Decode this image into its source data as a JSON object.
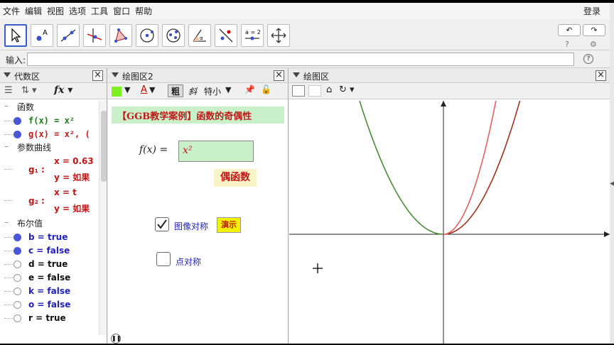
{
  "menu": {
    "items": [
      "文件",
      "编辑",
      "视图",
      "选项",
      "工具",
      "窗口",
      "帮助"
    ],
    "login": "登录"
  },
  "toolbar": {
    "tools": [
      "move-tool",
      "point-tool",
      "line-tool",
      "perpendicular-tool",
      "polygon-tool",
      "circle-tool",
      "conic-tool",
      "angle-tool",
      "reflect-tool",
      "slider-tool",
      "move-view-tool"
    ],
    "slider_label": "a = 2"
  },
  "input": {
    "label": "输入:",
    "value": ""
  },
  "algebra": {
    "title": "代数区",
    "categories": {
      "functions": "函数",
      "curves": "参数曲线",
      "booleans": "布尔值"
    },
    "functions": [
      {
        "name": "f(x) = x²",
        "color": "#1a7a1a"
      },
      {
        "name": "g(x) = x²,   (",
        "color": "#c01818"
      }
    ],
    "curves": [
      {
        "name": "g₁ :",
        "line1": "x = 0.63",
        "line2": "y = 如果",
        "visible": true
      },
      {
        "name": "g₂ :",
        "line1": "x = t",
        "line2": "y = 如果",
        "visible": false
      }
    ],
    "booleans": [
      {
        "label": "b = true",
        "visible": true,
        "color": "#2222bb"
      },
      {
        "label": "c = false",
        "visible": true,
        "color": "#2222bb"
      },
      {
        "label": "d = true",
        "visible": false,
        "color": "#111111"
      },
      {
        "label": "e = false",
        "visible": false,
        "color": "#111111"
      },
      {
        "label": "k = false",
        "visible": false,
        "color": "#2222bb"
      },
      {
        "label": "o = false",
        "visible": false,
        "color": "#2222bb"
      },
      {
        "label": "r = true",
        "visible": false,
        "color": "#111111"
      }
    ]
  },
  "graphics2": {
    "title": "绘图区2",
    "style_bold": "粗",
    "style_italic": "斜",
    "style_size": "特小",
    "heading": "【GGB教学案例】函数的奇偶性",
    "f_label": "f(x) =",
    "f_value": "x²",
    "even_button": "偶函数",
    "checkbox_image": {
      "label": "图像对称",
      "checked": true
    },
    "checkbox_point": {
      "label": "点对称",
      "checked": false
    },
    "demo_button": "演示"
  },
  "graphics1": {
    "title": "绘图区",
    "curve_colors": {
      "f": "#4a8a3a",
      "g": "#e06060",
      "g_dark": "#a03020"
    }
  }
}
